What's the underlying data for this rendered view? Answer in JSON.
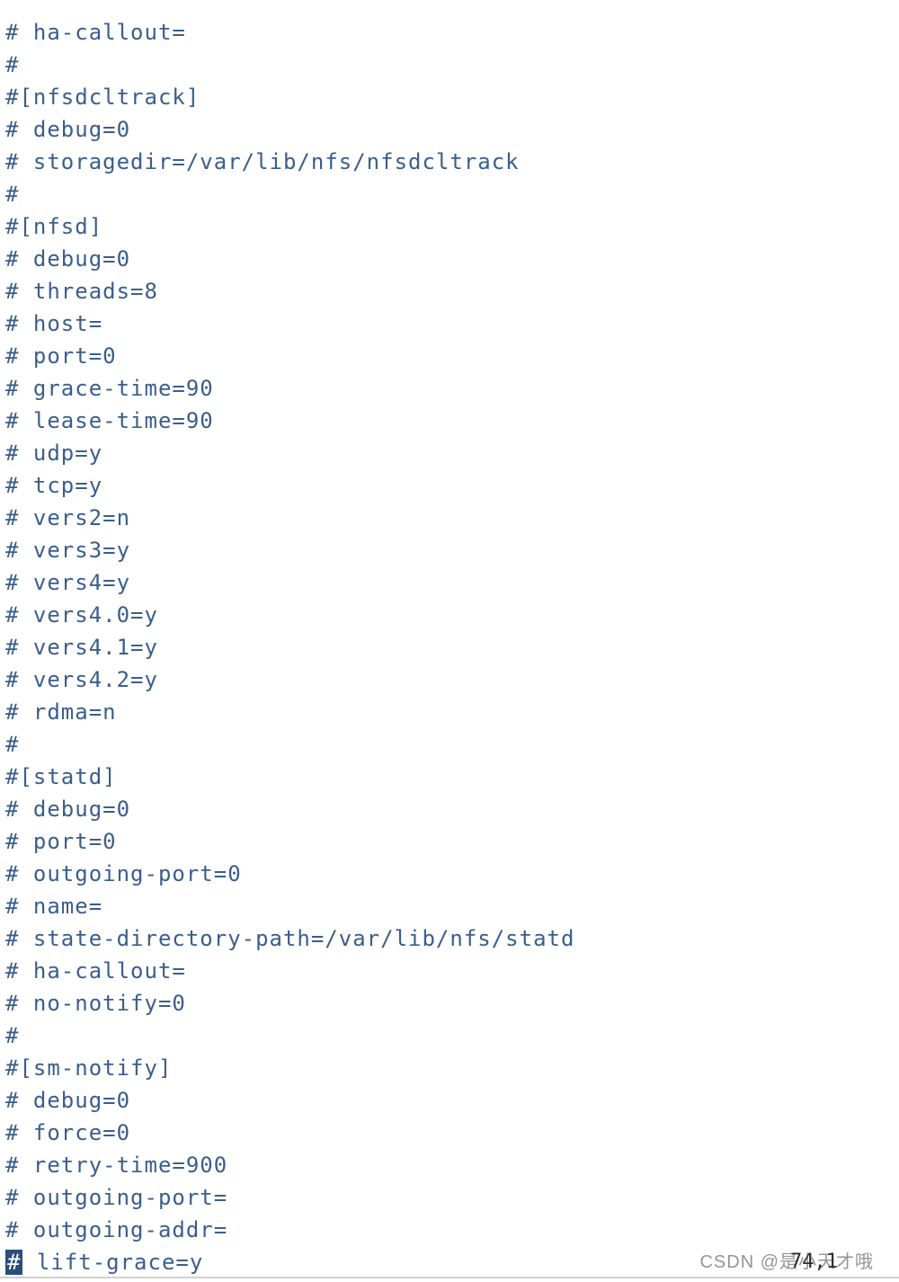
{
  "editor": {
    "cursor_char": "#",
    "last_line_rest": " lift-grace=y",
    "lines": [
      "# ha-callout=",
      "#",
      "#[nfsdcltrack]",
      "# debug=0",
      "# storagedir=/var/lib/nfs/nfsdcltrack",
      "#",
      "#[nfsd]",
      "# debug=0",
      "# threads=8",
      "# host=",
      "# port=0",
      "# grace-time=90",
      "# lease-time=90",
      "# udp=y",
      "# tcp=y",
      "# vers2=n",
      "# vers3=y",
      "# vers4=y",
      "# vers4.0=y",
      "# vers4.1=y",
      "# vers4.2=y",
      "# rdma=n",
      "#",
      "#[statd]",
      "# debug=0",
      "# port=0",
      "# outgoing-port=0",
      "# name=",
      "# state-directory-path=/var/lib/nfs/statd",
      "# ha-callout=",
      "# no-notify=0",
      "#",
      "#[sm-notify]",
      "# debug=0",
      "# force=0",
      "# retry-time=900",
      "# outgoing-port=",
      "# outgoing-addr="
    ]
  },
  "status": {
    "position": "74,1"
  },
  "watermark": {
    "text": "CSDN @是小天才哦"
  }
}
